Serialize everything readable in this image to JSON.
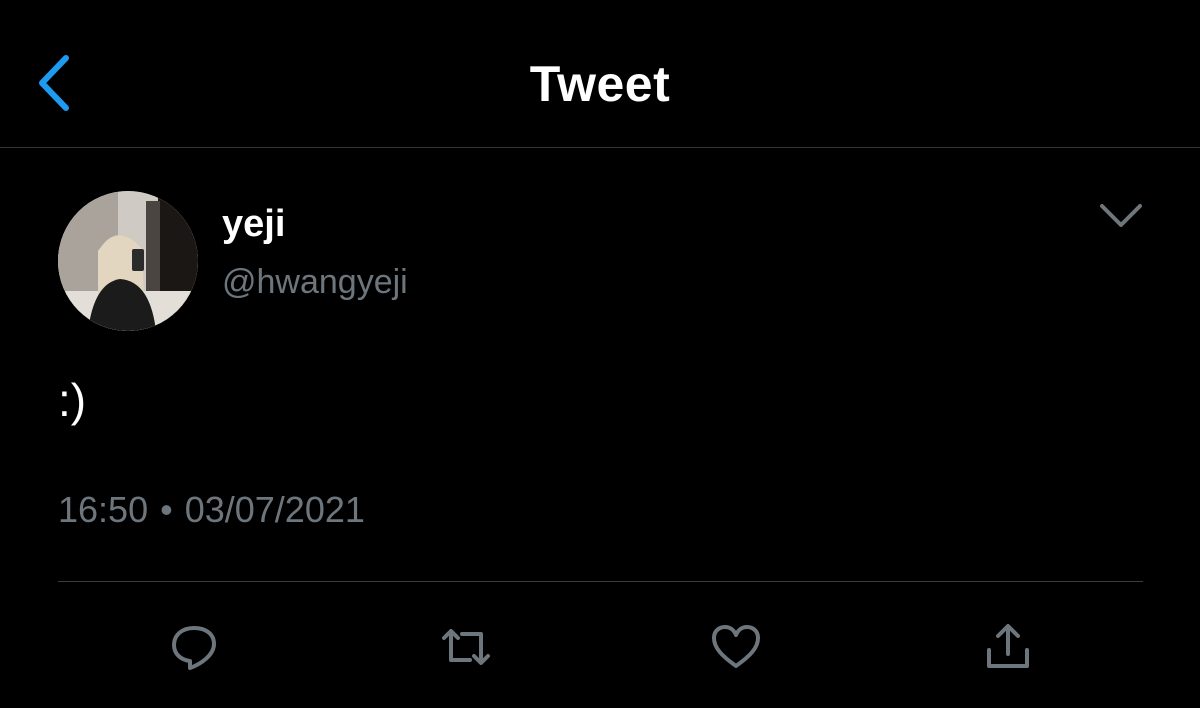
{
  "header": {
    "title": "Tweet",
    "back_icon": "chevron-left-icon"
  },
  "tweet": {
    "author": {
      "display_name": "yeji",
      "handle": "@hwangyeji"
    },
    "text": ":)",
    "time": "16:50",
    "separator": "•",
    "date": "03/07/2021"
  },
  "actions": [
    {
      "icon": "reply-icon"
    },
    {
      "icon": "retweet-icon"
    },
    {
      "icon": "like-icon"
    },
    {
      "icon": "share-icon"
    }
  ],
  "colors": {
    "background": "#000000",
    "accent": "#1d9bf0",
    "secondary_text": "#6e767d",
    "divider": "#3a3d40"
  }
}
